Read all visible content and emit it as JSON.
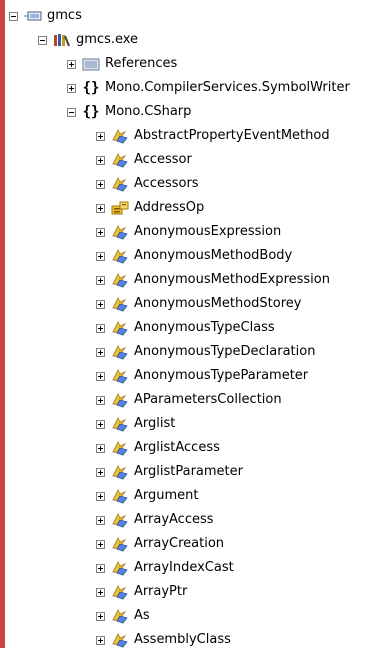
{
  "tree": {
    "root": {
      "label": "gmcs",
      "expanded": true,
      "icon": "project-icon"
    },
    "assembly": {
      "label": "gmcs.exe",
      "expanded": true,
      "icon": "assembly-icon"
    },
    "references": {
      "label": "References",
      "expanded": false,
      "icon": "references-icon"
    },
    "ns_symbolwriter": {
      "label": "Mono.CompilerServices.SymbolWriter",
      "expanded": false,
      "icon": "namespace-icon"
    },
    "ns_csharp": {
      "label": "Mono.CSharp",
      "expanded": true,
      "icon": "namespace-icon"
    },
    "classes": [
      {
        "label": "AbstractPropertyEventMethod",
        "icon": "class-icon"
      },
      {
        "label": "Accessor",
        "icon": "class-icon"
      },
      {
        "label": "Accessors",
        "icon": "class-icon"
      },
      {
        "label": "AddressOp",
        "icon": "enum-icon"
      },
      {
        "label": "AnonymousExpression",
        "icon": "class-icon"
      },
      {
        "label": "AnonymousMethodBody",
        "icon": "class-icon"
      },
      {
        "label": "AnonymousMethodExpression",
        "icon": "class-icon"
      },
      {
        "label": "AnonymousMethodStorey",
        "icon": "class-icon"
      },
      {
        "label": "AnonymousTypeClass",
        "icon": "class-icon"
      },
      {
        "label": "AnonymousTypeDeclaration",
        "icon": "class-icon"
      },
      {
        "label": "AnonymousTypeParameter",
        "icon": "class-icon"
      },
      {
        "label": "AParametersCollection",
        "icon": "class-icon"
      },
      {
        "label": "Arglist",
        "icon": "class-icon"
      },
      {
        "label": "ArglistAccess",
        "icon": "class-icon"
      },
      {
        "label": "ArglistParameter",
        "icon": "class-icon"
      },
      {
        "label": "Argument",
        "icon": "class-icon"
      },
      {
        "label": "ArrayAccess",
        "icon": "class-icon"
      },
      {
        "label": "ArrayCreation",
        "icon": "class-icon"
      },
      {
        "label": "ArrayIndexCast",
        "icon": "class-icon"
      },
      {
        "label": "ArrayPtr",
        "icon": "class-icon"
      },
      {
        "label": "As",
        "icon": "class-icon"
      },
      {
        "label": "AssemblyClass",
        "icon": "class-icon"
      }
    ]
  }
}
